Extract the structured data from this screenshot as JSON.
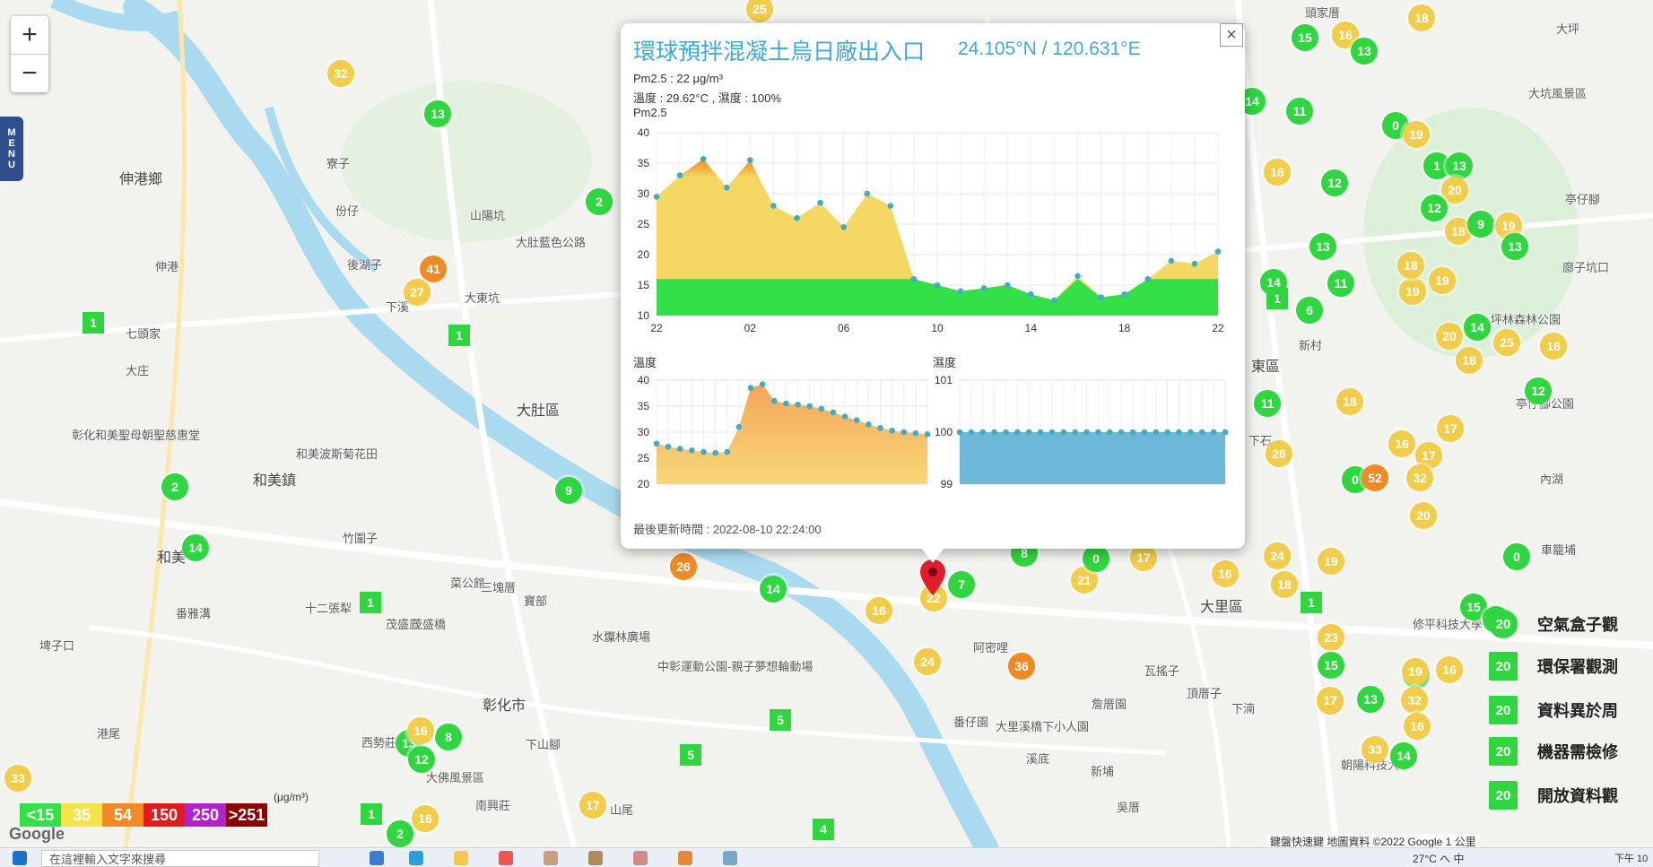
{
  "zoom": {
    "in_label": "+",
    "out_label": "−"
  },
  "menu_label": [
    "M",
    "E",
    "N",
    "U"
  ],
  "place_labels": [
    {
      "text": "伸港鄉",
      "big": true
    },
    {
      "text": "伸港",
      "big": false
    },
    {
      "text": "七頭家",
      "big": false
    },
    {
      "text": "大庄",
      "big": false
    },
    {
      "text": "和美鎮",
      "big": true
    },
    {
      "text": "和美",
      "big": true
    },
    {
      "text": "大肚區",
      "big": true
    },
    {
      "text": "彰化市",
      "big": true
    },
    {
      "text": "大里區",
      "big": true
    },
    {
      "text": "大坪",
      "big": false
    },
    {
      "text": "大坑風景區",
      "big": false
    },
    {
      "text": "頭家厝",
      "big": false
    },
    {
      "text": "寮子",
      "big": false
    },
    {
      "text": "份仔",
      "big": false
    },
    {
      "text": "山陽坑",
      "big": false
    },
    {
      "text": "後湖子",
      "big": false
    },
    {
      "text": "下溪",
      "big": false
    },
    {
      "text": "大東坑",
      "big": false
    },
    {
      "text": "竹圍子",
      "big": false
    },
    {
      "text": "十二張犁",
      "big": false
    },
    {
      "text": "茂盛厝",
      "big": false
    },
    {
      "text": "菜公館",
      "big": false
    },
    {
      "text": "三塊厝",
      "big": false
    },
    {
      "text": "寶部",
      "big": false
    },
    {
      "text": "番雅溝",
      "big": false
    },
    {
      "text": "埤子口",
      "big": false
    },
    {
      "text": "港尾",
      "big": false
    },
    {
      "text": "西勢莊",
      "big": false
    },
    {
      "text": "南興莊",
      "big": false
    },
    {
      "text": "下山腳",
      "big": false
    },
    {
      "text": "山尾",
      "big": false
    },
    {
      "text": "阿密哩",
      "big": false
    },
    {
      "text": "番仔園",
      "big": false
    },
    {
      "text": "溪底",
      "big": false
    },
    {
      "text": "新埔",
      "big": false
    },
    {
      "text": "吳厝",
      "big": false
    },
    {
      "text": "瓦搖子",
      "big": false
    },
    {
      "text": "詹厝園",
      "big": false
    },
    {
      "text": "頂厝子",
      "big": false
    },
    {
      "text": "下湳",
      "big": false
    },
    {
      "text": "內湖",
      "big": false
    },
    {
      "text": "車籠埔",
      "big": false
    },
    {
      "text": "亭仔腳",
      "big": false
    },
    {
      "text": "廍子坑口",
      "big": false
    },
    {
      "text": "東區",
      "big": true
    },
    {
      "text": "下石",
      "big": false
    },
    {
      "text": "新村",
      "big": false
    },
    {
      "text": "茂盛橋",
      "big": false
    },
    {
      "text": "水源林廣場",
      "big": false
    },
    {
      "text": "大肚藍色公路",
      "big": false
    },
    {
      "text": "水燦林廣場",
      "big": false
    },
    {
      "text": "彰化和美聖母朝聖慈惠堂",
      "big": false
    },
    {
      "text": "和美波斯菊花田",
      "big": false
    },
    {
      "text": "大佛風景區",
      "big": false
    },
    {
      "text": "大里溪橋下小人園",
      "big": false
    },
    {
      "text": "中彰運動公園-親子夢想輪動場",
      "big": false
    },
    {
      "text": "修平科技大學",
      "big": false
    },
    {
      "text": "朝陽科技大學",
      "big": false
    },
    {
      "text": "坪林森林公園",
      "big": false
    },
    {
      "text": "亭仔腳公園",
      "big": false
    }
  ],
  "markers": [
    {
      "v": "32",
      "c": "yellow"
    },
    {
      "v": "13",
      "c": "green"
    },
    {
      "v": "2",
      "c": "green"
    },
    {
      "v": "41",
      "c": "orange"
    },
    {
      "v": "27",
      "c": "yellow"
    },
    {
      "v": "1",
      "c": "green",
      "sq": true
    },
    {
      "v": "1",
      "c": "green",
      "sq": true
    },
    {
      "v": "2",
      "c": "green"
    },
    {
      "v": "14",
      "c": "green"
    },
    {
      "v": "9",
      "c": "green"
    },
    {
      "v": "1",
      "c": "green",
      "sq": true
    },
    {
      "v": "26",
      "c": "orange"
    },
    {
      "v": "14",
      "c": "green"
    },
    {
      "v": "16",
      "c": "yellow"
    },
    {
      "v": "22",
      "c": "yellow"
    },
    {
      "v": "7",
      "c": "green"
    },
    {
      "v": "24",
      "c": "yellow"
    },
    {
      "v": "36",
      "c": "orange"
    },
    {
      "v": "21",
      "c": "yellow"
    },
    {
      "v": "8",
      "c": "green"
    },
    {
      "v": "0",
      "c": "green"
    },
    {
      "v": "17",
      "c": "yellow"
    },
    {
      "v": "16",
      "c": "yellow"
    },
    {
      "v": "5",
      "c": "green",
      "sq": true
    },
    {
      "v": "5",
      "c": "green",
      "sq": true
    },
    {
      "v": "4",
      "c": "green",
      "sq": true
    },
    {
      "v": "13",
      "c": "green"
    },
    {
      "v": "12",
      "c": "green"
    },
    {
      "v": "8",
      "c": "green"
    },
    {
      "v": "16",
      "c": "yellow"
    },
    {
      "v": "33",
      "c": "yellow"
    },
    {
      "v": "1",
      "c": "green",
      "sq": true
    },
    {
      "v": "2",
      "c": "green"
    },
    {
      "v": "16",
      "c": "yellow"
    },
    {
      "v": "17",
      "c": "yellow"
    },
    {
      "v": "25",
      "c": "yellow"
    },
    {
      "v": "18",
      "c": "yellow"
    },
    {
      "v": "15",
      "c": "green"
    },
    {
      "v": "16",
      "c": "yellow"
    },
    {
      "v": "13",
      "c": "green"
    },
    {
      "v": "14",
      "c": "green"
    },
    {
      "v": "11",
      "c": "green"
    },
    {
      "v": "0",
      "c": "green"
    },
    {
      "v": "19",
      "c": "yellow"
    },
    {
      "v": "1",
      "c": "green"
    },
    {
      "v": "13",
      "c": "green"
    },
    {
      "v": "16",
      "c": "yellow"
    },
    {
      "v": "12",
      "c": "green"
    },
    {
      "v": "20",
      "c": "yellow"
    },
    {
      "v": "12",
      "c": "green"
    },
    {
      "v": "18",
      "c": "yellow"
    },
    {
      "v": "9",
      "c": "green"
    },
    {
      "v": "13",
      "c": "green"
    },
    {
      "v": "11",
      "c": "green"
    },
    {
      "v": "19",
      "c": "yellow"
    },
    {
      "v": "19",
      "c": "yellow"
    },
    {
      "v": "13",
      "c": "green"
    },
    {
      "v": "14",
      "c": "green"
    },
    {
      "v": "1",
      "c": "green",
      "sq": true
    },
    {
      "v": "6",
      "c": "green"
    },
    {
      "v": "18",
      "c": "yellow"
    },
    {
      "v": "19",
      "c": "yellow"
    },
    {
      "v": "20",
      "c": "yellow"
    },
    {
      "v": "14",
      "c": "green"
    },
    {
      "v": "25",
      "c": "yellow"
    },
    {
      "v": "16",
      "c": "yellow"
    },
    {
      "v": "11",
      "c": "green"
    },
    {
      "v": "18",
      "c": "yellow"
    },
    {
      "v": "12",
      "c": "green"
    },
    {
      "v": "18",
      "c": "yellow"
    },
    {
      "v": "17",
      "c": "yellow"
    },
    {
      "v": "16",
      "c": "yellow"
    },
    {
      "v": "17",
      "c": "yellow"
    },
    {
      "v": "0",
      "c": "green"
    },
    {
      "v": "52",
      "c": "orange"
    },
    {
      "v": "20",
      "c": "yellow"
    },
    {
      "v": "24",
      "c": "yellow"
    },
    {
      "v": "32",
      "c": "yellow"
    },
    {
      "v": "26",
      "c": "yellow"
    },
    {
      "v": "19",
      "c": "yellow"
    },
    {
      "v": "18",
      "c": "yellow"
    },
    {
      "v": "1",
      "c": "green",
      "sq": true
    },
    {
      "v": "23",
      "c": "yellow"
    },
    {
      "v": "15",
      "c": "green"
    },
    {
      "v": "14",
      "c": "green"
    },
    {
      "v": "19",
      "c": "yellow"
    },
    {
      "v": "32",
      "c": "yellow"
    },
    {
      "v": "36",
      "c": "orange"
    },
    {
      "v": "33",
      "c": "yellow"
    },
    {
      "v": "15",
      "c": "green"
    },
    {
      "v": "9",
      "c": "green"
    },
    {
      "v": "16",
      "c": "yellow"
    },
    {
      "v": "16",
      "c": "yellow"
    },
    {
      "v": "17",
      "c": "yellow"
    },
    {
      "v": "0",
      "c": "green"
    },
    {
      "v": "14",
      "c": "green"
    },
    {
      "v": "13",
      "c": "green"
    },
    {
      "v": "12",
      "c": "green"
    },
    {
      "v": "16",
      "c": "yellow"
    }
  ],
  "popup": {
    "close_label": "×",
    "title": "環球預拌混凝土烏日廠出入口",
    "coords": "24.105°N / 120.631°E",
    "pm_line": "Pm2.5 : 22 μg/m³",
    "temp_line": "溫度 : 29.62°C , 濕度 : 100%",
    "chart_title": "Pm2.5",
    "temp_title": "溫度",
    "hum_title": "濕度",
    "updated": "最後更新時間 : 2022-08-10 22:24:00"
  },
  "chart_data": [
    {
      "type": "area",
      "title": "Pm2.5",
      "x_tick_labels": [
        "22",
        "02",
        "06",
        "10",
        "14",
        "18",
        "22"
      ],
      "ylim": [
        10,
        40
      ],
      "y_ticks": [
        10,
        15,
        20,
        25,
        30,
        35,
        40
      ],
      "threshold": 16,
      "colors": {
        "above": "#f5d763",
        "peak": "#f08a25",
        "below": "#33e048",
        "point": "#3dadc8"
      },
      "values": [
        29.5,
        33,
        35.7,
        31,
        35.5,
        28,
        26,
        28.5,
        24.5,
        30,
        28,
        16,
        15,
        14,
        14.5,
        15,
        13.5,
        12.5,
        16.5,
        13,
        13.5,
        16,
        19,
        18.5,
        20.5
      ]
    },
    {
      "type": "area",
      "title": "溫度",
      "ylim": [
        20,
        40
      ],
      "y_ticks": [
        20,
        25,
        30,
        35,
        40
      ],
      "colors": {
        "fill_top": "#f4a55a",
        "fill_bottom": "#f8d878",
        "point": "#3dadc8"
      },
      "values": [
        27.8,
        27.2,
        26.8,
        26.5,
        26.2,
        26,
        26.2,
        31,
        38.5,
        39.2,
        36,
        35.5,
        35.3,
        35,
        34.5,
        33.8,
        33,
        32.3,
        31.5,
        30.8,
        30.3,
        30,
        29.8,
        29.6
      ]
    },
    {
      "type": "area",
      "title": "濕度",
      "ylim": [
        99,
        101
      ],
      "y_ticks": [
        99,
        100,
        101
      ],
      "colors": {
        "fill": "#6cb8d8",
        "point": "#3dadc8"
      },
      "values": [
        100,
        100,
        100,
        100,
        100,
        100,
        100,
        100,
        100,
        100,
        100,
        100,
        100,
        100,
        100,
        100,
        100,
        100,
        100,
        100,
        100,
        100,
        100,
        100
      ]
    }
  ],
  "legend": {
    "unit": "(μg/m³)",
    "items": [
      {
        "label": "<15",
        "color": "#33e048"
      },
      {
        "label": "35",
        "color": "#f5e34a"
      },
      {
        "label": "54",
        "color": "#f08a25"
      },
      {
        "label": "150",
        "color": "#e31a1c"
      },
      {
        "label": "250",
        "color": "#b221c9"
      },
      {
        "label": ">251",
        "color": "#8b0000"
      }
    ]
  },
  "right_legend": [
    {
      "badge": "20",
      "text": "空氣盒子觀"
    },
    {
      "badge": "20",
      "text": "環保署觀測"
    },
    {
      "badge": "20",
      "text": "資料異於周"
    },
    {
      "badge": "20",
      "text": "機器需檢修"
    },
    {
      "badge": "20",
      "text": "開放資料觀"
    }
  ],
  "attribution": "鍵盤快速鍵   地圖資料 ©2022 Google   1 公里",
  "google_logo": "Google",
  "taskbar": {
    "search_placeholder": "在這裡輸入文字來搜尋",
    "status": "27°C  へ 中",
    "time": "下午 10"
  }
}
